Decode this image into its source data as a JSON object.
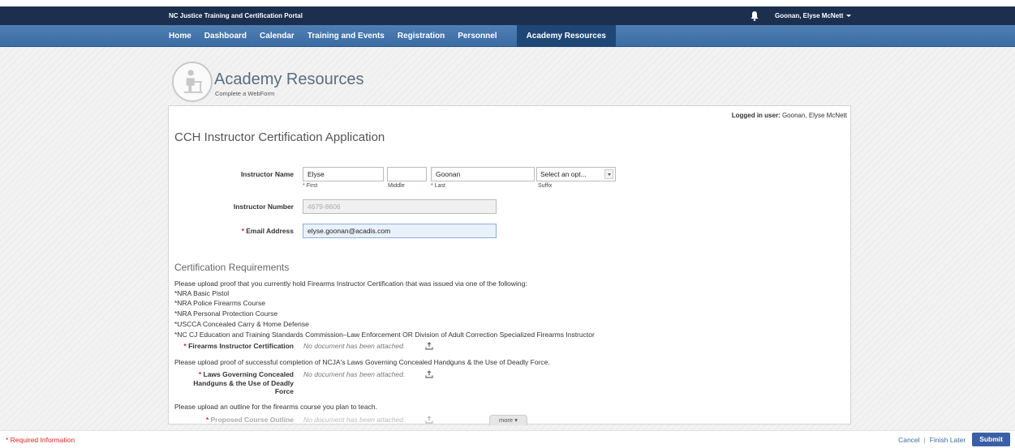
{
  "header": {
    "portal_title": "NC Justice Training and Certification Portal",
    "user_name": "Goonan, Elyse McNett"
  },
  "nav": {
    "items": [
      "Home",
      "Dashboard",
      "Calendar",
      "Training and Events",
      "Registration",
      "Personnel"
    ],
    "active": "Academy Resources"
  },
  "page": {
    "heading": "Academy Resources",
    "subheading": "Complete a WebForm"
  },
  "form": {
    "logged_in_label": "Logged in user:",
    "logged_in_user": "Goonan, Elyse McNett",
    "title": "CCH Instructor Certification Application",
    "instructor_name_label": "Instructor Name",
    "first_value": "Elyse",
    "middle_value": "",
    "last_value": "Goonan",
    "suffix_value": "Select an opt...",
    "first_sub": "First",
    "middle_sub": "Middle",
    "last_sub": "Last",
    "suffix_sub": "Suffix",
    "required_mark": "*",
    "instructor_number_label": "Instructor Number",
    "instructor_number_value": "4679-8606",
    "email_label": "Email Address",
    "email_value": "elyse.goonan@acadis.com"
  },
  "requirements": {
    "title": "Certification Requirements",
    "intro": "Please upload proof that you currently hold Firearms Instructor Certification that was issued via one of the following:",
    "list": [
      "*NRA Basic Pistol",
      "*NRA Police Firearms Course",
      "*NRA Personal Protection Course",
      "*USCCA Concealed Carry & Home Defense",
      "*NC CJ Education and Training Standards Commission–Law Enforcement OR Division of Adult Correction Specialized Firearms Instructor"
    ],
    "firearms_label": "Firearms Instructor Certification",
    "laws_intro": "Please upload proof of successful completion of NCJA's Laws Governing Concealed Handguns & the Use of Deadly Force.",
    "laws_label_1": "Laws Governing Concealed",
    "laws_label_2": "Handguns & the Use of Deadly",
    "laws_label_3": "Force",
    "outline_intro": "Please upload an outline for the firearms course you plan to teach.",
    "outline_label": "Proposed Course Outline",
    "no_doc": "No document has been attached."
  },
  "more_label": "more",
  "footer": {
    "required_info": "* Required Information",
    "cancel": "Cancel",
    "finish_later": "Finish Later",
    "submit": "Submit"
  },
  "colors": {
    "topbar": "#1c2f4f",
    "navbar": "#3a6ba3",
    "nav_active": "#1f4776",
    "required": "#dd2222",
    "submit": "#3a5fa6"
  }
}
